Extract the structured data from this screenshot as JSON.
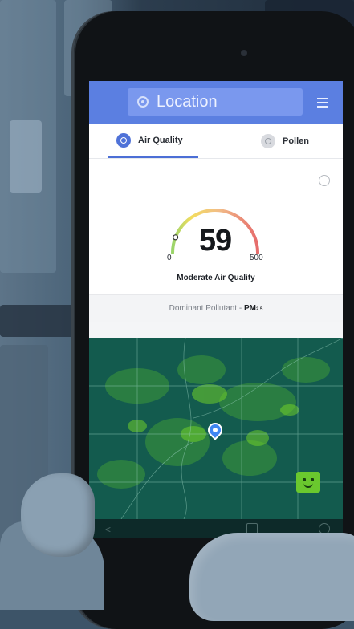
{
  "header": {
    "location_label": "Location",
    "location_icon": "location-target-icon",
    "menu_icon": "hamburger-menu-icon"
  },
  "tabs": [
    {
      "label": "Air Quality",
      "icon": "air-quality-icon",
      "selected": true
    },
    {
      "label": "Pollen",
      "icon": "pollen-icon",
      "selected": false
    }
  ],
  "aqi": {
    "value": "59",
    "scale_min": "0",
    "scale_max": "500",
    "level_fraction": 0.118,
    "category": "Moderate Air Quality",
    "dominant_prefix": "Dominant Pollutant - ",
    "dominant_value": "PM",
    "dominant_sub": "2.5"
  },
  "map": {
    "pin_icon": "location-pin-icon",
    "feedback_icon": "smiley-face-icon"
  },
  "navbar": {
    "back_icon": "back-arrow-icon",
    "home_icon": "home-square-icon",
    "recent_icon": "circle-icon",
    "back_glyph": "<"
  },
  "colors": {
    "header": "#5b7fe1",
    "tab_indicator": "#4c6fd6",
    "gauge_green": "#8ed05a",
    "gauge_yellow": "#f2d94d",
    "gauge_red": "#e35b5b",
    "map_base": "#12564e"
  }
}
